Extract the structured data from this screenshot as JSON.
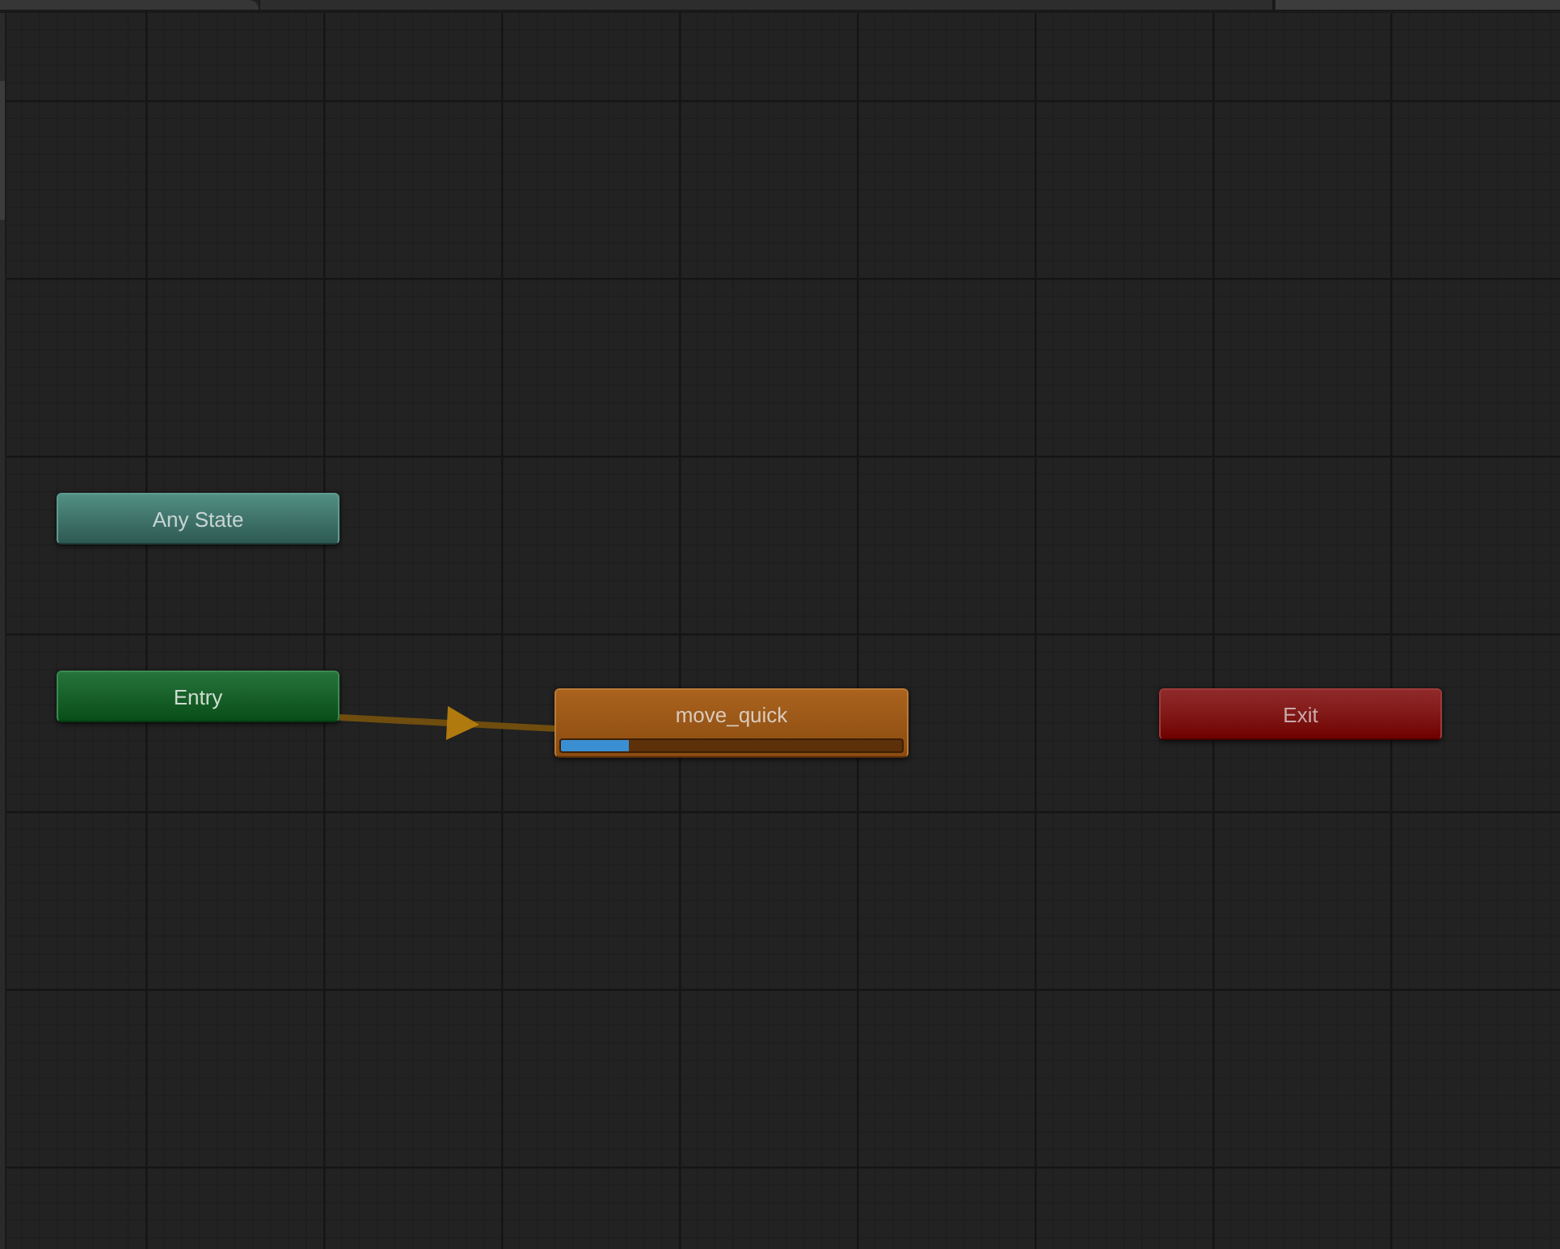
{
  "graph": {
    "nodes": [
      {
        "label": "Any State",
        "kind": "any_state"
      },
      {
        "label": "Entry",
        "kind": "entry"
      },
      {
        "label": "move_quick",
        "kind": "default_state",
        "level": 0.2
      },
      {
        "label": "Exit",
        "kind": "exit"
      }
    ],
    "transitions": [
      {
        "kind": "entry_to_default"
      }
    ]
  }
}
